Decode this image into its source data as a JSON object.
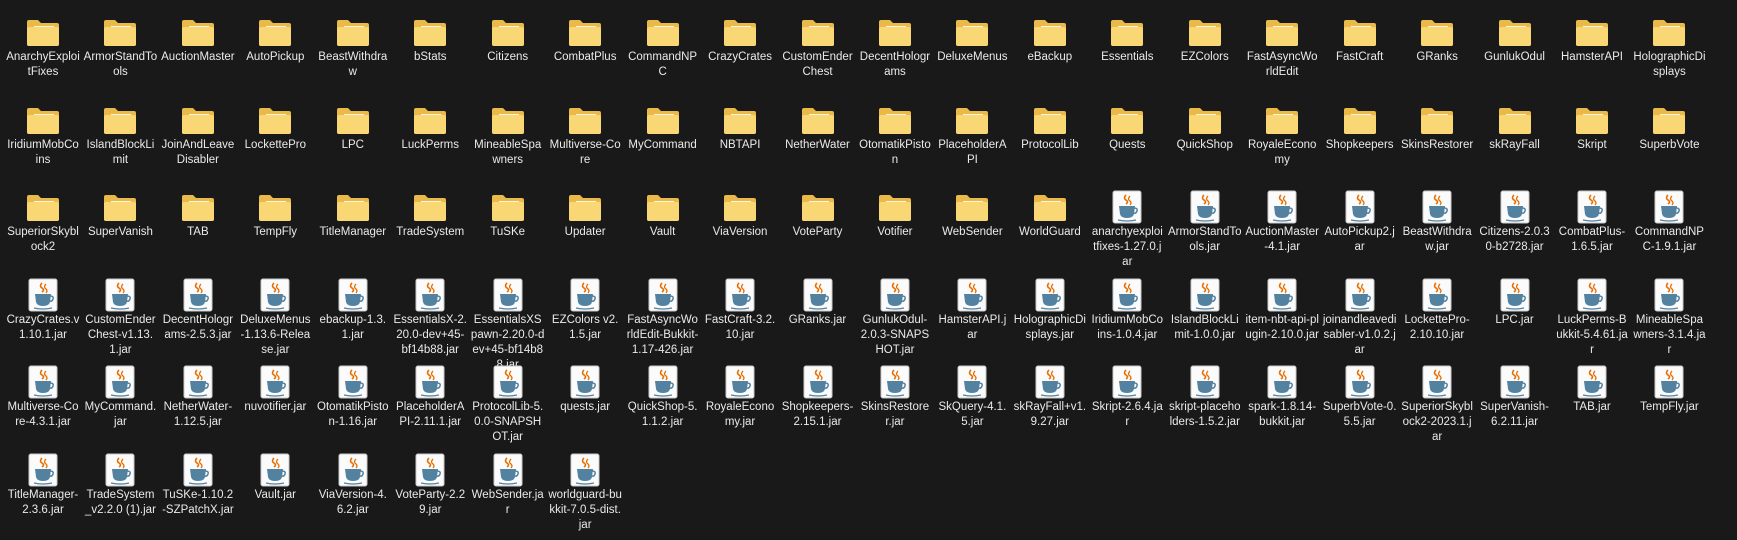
{
  "icons": {
    "folder": "folder-icon",
    "jar": "java-jar-icon"
  },
  "colors": {
    "background": "#191919",
    "text": "#eaeaea",
    "folder_body": "#f8d774",
    "folder_back": "#e9b949",
    "java_red": "#e76f00",
    "java_blue": "#5382a1"
  },
  "rows": [
    [
      {
        "kind": "folder",
        "label": "AnarchyExploitFixes"
      },
      {
        "kind": "folder",
        "label": "ArmorStandTools"
      },
      {
        "kind": "folder",
        "label": "AuctionMaster"
      },
      {
        "kind": "folder",
        "label": "AutoPickup"
      },
      {
        "kind": "folder",
        "label": "BeastWithdraw"
      },
      {
        "kind": "folder",
        "label": "bStats"
      },
      {
        "kind": "folder",
        "label": "Citizens"
      },
      {
        "kind": "folder",
        "label": "CombatPlus"
      },
      {
        "kind": "folder",
        "label": "CommandNPC"
      },
      {
        "kind": "folder",
        "label": "CrazyCrates"
      },
      {
        "kind": "folder",
        "label": "CustomEnderChest"
      },
      {
        "kind": "folder",
        "label": "DecentHolograms"
      },
      {
        "kind": "folder",
        "label": "DeluxeMenus"
      },
      {
        "kind": "folder",
        "label": "eBackup"
      },
      {
        "kind": "folder",
        "label": "Essentials"
      },
      {
        "kind": "folder",
        "label": "EZColors"
      },
      {
        "kind": "folder",
        "label": "FastAsyncWorldEdit"
      },
      {
        "kind": "folder",
        "label": "FastCraft"
      },
      {
        "kind": "folder",
        "label": "GRanks"
      },
      {
        "kind": "folder",
        "label": "GunlukOdul"
      },
      {
        "kind": "folder",
        "label": "HamsterAPI"
      },
      {
        "kind": "folder",
        "label": "HolographicDisplays"
      }
    ],
    [
      {
        "kind": "folder",
        "label": "IridiumMobCoins"
      },
      {
        "kind": "folder",
        "label": "IslandBlockLimit"
      },
      {
        "kind": "folder",
        "label": "JoinAndLeaveDisabler"
      },
      {
        "kind": "folder",
        "label": "LockettePro"
      },
      {
        "kind": "folder",
        "label": "LPC"
      },
      {
        "kind": "folder",
        "label": "LuckPerms"
      },
      {
        "kind": "folder",
        "label": "MineableSpawners"
      },
      {
        "kind": "folder",
        "label": "Multiverse-Core"
      },
      {
        "kind": "folder",
        "label": "MyCommand"
      },
      {
        "kind": "folder",
        "label": "NBTAPI"
      },
      {
        "kind": "folder",
        "label": "NetherWater"
      },
      {
        "kind": "folder",
        "label": "OtomatikPiston"
      },
      {
        "kind": "folder",
        "label": "PlaceholderAPI"
      },
      {
        "kind": "folder",
        "label": "ProtocolLib"
      },
      {
        "kind": "folder",
        "label": "Quests"
      },
      {
        "kind": "folder",
        "label": "QuickShop"
      },
      {
        "kind": "folder",
        "label": "RoyaleEconomy"
      },
      {
        "kind": "folder",
        "label": "Shopkeepers"
      },
      {
        "kind": "folder",
        "label": "SkinsRestorer"
      },
      {
        "kind": "folder",
        "label": "skRayFall"
      },
      {
        "kind": "folder",
        "label": "Skript"
      },
      {
        "kind": "folder",
        "label": "SuperbVote"
      }
    ],
    [
      {
        "kind": "folder",
        "label": "SuperiorSkyblock2"
      },
      {
        "kind": "folder",
        "label": "SuperVanish"
      },
      {
        "kind": "folder",
        "label": "TAB"
      },
      {
        "kind": "folder",
        "label": "TempFly"
      },
      {
        "kind": "folder",
        "label": "TitleManager"
      },
      {
        "kind": "folder",
        "label": "TradeSystem"
      },
      {
        "kind": "folder",
        "label": "TuSKe"
      },
      {
        "kind": "folder",
        "label": "Updater"
      },
      {
        "kind": "folder",
        "label": "Vault"
      },
      {
        "kind": "folder",
        "label": "ViaVersion"
      },
      {
        "kind": "folder",
        "label": "VoteParty"
      },
      {
        "kind": "folder",
        "label": "Votifier"
      },
      {
        "kind": "folder",
        "label": "WebSender"
      },
      {
        "kind": "folder",
        "label": "WorldGuard"
      },
      {
        "kind": "jar",
        "label": "anarchyexploitfixes-1.27.0.jar"
      },
      {
        "kind": "jar",
        "label": "ArmorStandTools.jar"
      },
      {
        "kind": "jar",
        "label": "AuctionMaster-4.1.jar"
      },
      {
        "kind": "jar",
        "label": "AutoPickup2.jar"
      },
      {
        "kind": "jar",
        "label": "BeastWithdraw.jar"
      },
      {
        "kind": "jar",
        "label": "Citizens-2.0.30-b2728.jar"
      },
      {
        "kind": "jar",
        "label": "CombatPlus-1.6.5.jar"
      },
      {
        "kind": "jar",
        "label": "CommandNPC-1.9.1.jar"
      }
    ],
    [
      {
        "kind": "jar",
        "label": "CrazyCrates.v1.10.1.jar"
      },
      {
        "kind": "jar",
        "label": "CustomEnderChest-v1.13.1.jar"
      },
      {
        "kind": "jar",
        "label": "DecentHolograms-2.5.3.jar"
      },
      {
        "kind": "jar",
        "label": "DeluxeMenus-1.13.6-Release.jar"
      },
      {
        "kind": "jar",
        "label": "ebackup-1.3.1.jar"
      },
      {
        "kind": "jar",
        "label": "EssentialsX-2.20.0-dev+45-bf14b88.jar"
      },
      {
        "kind": "jar",
        "label": "EssentialsXSpawn-2.20.0-dev+45-bf14b88.jar"
      },
      {
        "kind": "jar",
        "label": "EZColors v2.1.5.jar"
      },
      {
        "kind": "jar",
        "label": "FastAsyncWorldEdit-Bukkit-1.17-426.jar"
      },
      {
        "kind": "jar",
        "label": "FastCraft-3.2.10.jar"
      },
      {
        "kind": "jar",
        "label": "GRanks.jar"
      },
      {
        "kind": "jar",
        "label": "GunlukOdul-2.0.3-SNAPSHOT.jar"
      },
      {
        "kind": "jar",
        "label": "HamsterAPI.jar"
      },
      {
        "kind": "jar",
        "label": "HolographicDisplays.jar"
      },
      {
        "kind": "jar",
        "label": "IridiumMobCoins-1.0.4.jar"
      },
      {
        "kind": "jar",
        "label": "IslandBlockLimit-1.0.0.jar"
      },
      {
        "kind": "jar",
        "label": "item-nbt-api-plugin-2.10.0.jar"
      },
      {
        "kind": "jar",
        "label": "joinandleavedisabler-v1.0.2.jar"
      },
      {
        "kind": "jar",
        "label": "LockettePro-2.10.10.jar"
      },
      {
        "kind": "jar",
        "label": "LPC.jar"
      },
      {
        "kind": "jar",
        "label": "LuckPerms-Bukkit-5.4.61.jar"
      },
      {
        "kind": "jar",
        "label": "MineableSpawners-3.1.4.jar"
      }
    ],
    [
      {
        "kind": "jar",
        "label": "Multiverse-Core-4.3.1.jar"
      },
      {
        "kind": "jar",
        "label": "MyCommand.jar"
      },
      {
        "kind": "jar",
        "label": "NetherWater-1.12.5.jar"
      },
      {
        "kind": "jar",
        "label": "nuvotifier.jar"
      },
      {
        "kind": "jar",
        "label": "OtomatikPiston-1.16.jar"
      },
      {
        "kind": "jar",
        "label": "PlaceholderAPI-2.11.1.jar"
      },
      {
        "kind": "jar",
        "label": "ProtocolLib-5.0.0-SNAPSHOT.jar"
      },
      {
        "kind": "jar",
        "label": "quests.jar"
      },
      {
        "kind": "jar",
        "label": "QuickShop-5.1.1.2.jar"
      },
      {
        "kind": "jar",
        "label": "RoyaleEconomy.jar"
      },
      {
        "kind": "jar",
        "label": "Shopkeepers-2.15.1.jar"
      },
      {
        "kind": "jar",
        "label": "SkinsRestorer.jar"
      },
      {
        "kind": "jar",
        "label": "SkQuery-4.1.5.jar"
      },
      {
        "kind": "jar",
        "label": "skRayFall+v1.9.27.jar"
      },
      {
        "kind": "jar",
        "label": "Skript-2.6.4.jar"
      },
      {
        "kind": "jar",
        "label": "skript-placeholders-1.5.2.jar"
      },
      {
        "kind": "jar",
        "label": "spark-1.8.14-bukkit.jar"
      },
      {
        "kind": "jar",
        "label": "SuperbVote-0.5.5.jar"
      },
      {
        "kind": "jar",
        "label": "SuperiorSkyblock2-2023.1.jar"
      },
      {
        "kind": "jar",
        "label": "SuperVanish-6.2.11.jar"
      },
      {
        "kind": "jar",
        "label": "TAB.jar"
      },
      {
        "kind": "jar",
        "label": "TempFly.jar"
      }
    ],
    [
      {
        "kind": "jar",
        "label": "TitleManager-2.3.6.jar"
      },
      {
        "kind": "jar",
        "label": "TradeSystem_v2.2.0 (1).jar"
      },
      {
        "kind": "jar",
        "label": "TuSKe-1.10.2-SZPatchX.jar"
      },
      {
        "kind": "jar",
        "label": "Vault.jar"
      },
      {
        "kind": "jar",
        "label": "ViaVersion-4.6.2.jar"
      },
      {
        "kind": "jar",
        "label": "VoteParty-2.29.jar"
      },
      {
        "kind": "jar",
        "label": "WebSender.jar"
      },
      {
        "kind": "jar",
        "label": "worldguard-bukkit-7.0.5-dist.jar"
      }
    ]
  ]
}
